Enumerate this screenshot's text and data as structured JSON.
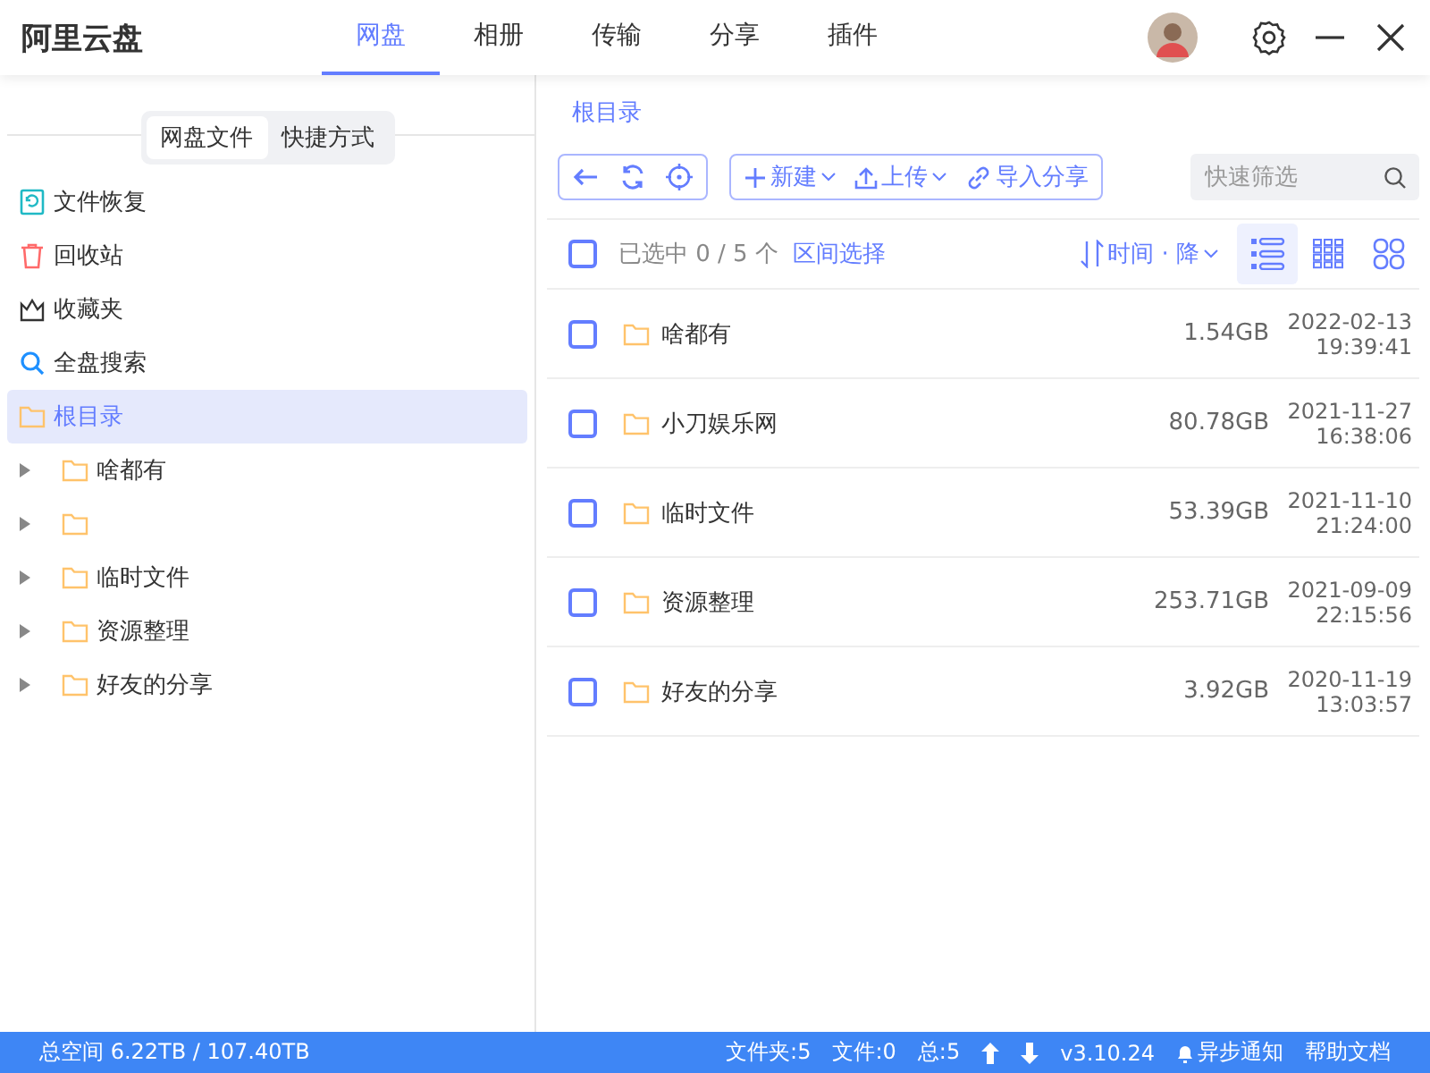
{
  "app_title": "阿里云盘",
  "nav_tabs": [
    {
      "label": "网盘",
      "selected": true
    },
    {
      "label": "相册",
      "selected": false
    },
    {
      "label": "传输",
      "selected": false
    },
    {
      "label": "分享",
      "selected": false
    },
    {
      "label": "插件",
      "selected": false
    }
  ],
  "sidebar": {
    "segments": [
      {
        "label": "网盘文件",
        "selected": true
      },
      {
        "label": "快捷方式",
        "selected": false
      }
    ],
    "items": [
      {
        "kind": "restore",
        "label": "文件恢复"
      },
      {
        "kind": "trash",
        "label": "回收站"
      },
      {
        "kind": "favorites",
        "label": "收藏夹"
      },
      {
        "kind": "search",
        "label": "全盘搜索"
      }
    ],
    "tree": {
      "label": "根目录",
      "selected": true,
      "children": [
        {
          "label": "啥都有",
          "expanded": false
        },
        {
          "expanded": false
        },
        {
          "label": "临时文件",
          "expanded": false
        },
        {
          "label": "资源整理",
          "expanded": false
        },
        {
          "label": "好友的分享",
          "expanded": false
        }
      ]
    }
  },
  "breadcrumb": "根目录",
  "toolbar": {
    "actions": [
      {
        "label": "新建",
        "dropdown": true
      },
      {
        "label": "上传",
        "dropdown": true
      },
      {
        "label": "导入分享",
        "dropdown": false
      }
    ],
    "filter_placeholder": "快速筛选"
  },
  "list_header": {
    "selection": "已选中 0 / 5 个",
    "checked": false,
    "range_select": "区间选择",
    "sort": "时间 · 降",
    "views": [
      {
        "kind": "list",
        "selected": true
      },
      {
        "kind": "grid",
        "selected": false
      },
      {
        "kind": "tiles",
        "selected": false
      }
    ]
  },
  "files": [
    {
      "name": "啥都有",
      "size": "1.54GB",
      "date": "2022-02-13",
      "time": "19:39:41",
      "checked": false
    },
    {
      "name": "小刀娱乐网",
      "size": "80.78GB",
      "date": "2021-11-27",
      "time": "16:38:06",
      "checked": false
    },
    {
      "name": "临时文件",
      "size": "53.39GB",
      "date": "2021-11-10",
      "time": "21:24:00",
      "checked": false
    },
    {
      "name": "资源整理",
      "size": "253.71GB",
      "date": "2021-09-09",
      "time": "22:15:56",
      "checked": false
    },
    {
      "name": "好友的分享",
      "size": "3.92GB",
      "date": "2020-11-19",
      "time": "13:03:57",
      "checked": false
    }
  ],
  "status_bar": {
    "space": "总空间 6.22TB / 107.40TB",
    "folders": "文件夹:5",
    "files": "文件:0",
    "total": "总:5",
    "version": "v3.10.24",
    "async": "异步通知",
    "help": "帮助文档"
  }
}
